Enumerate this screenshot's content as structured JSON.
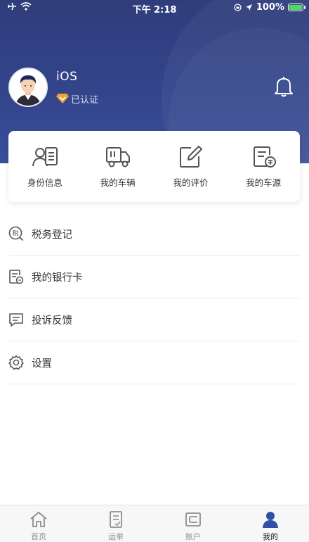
{
  "status_bar": {
    "time": "下午 2:18",
    "battery": "100%"
  },
  "profile": {
    "username": "iOS",
    "verified_label": "已认证"
  },
  "quick_actions": [
    {
      "label": "身份信息",
      "icon": "id-card-icon"
    },
    {
      "label": "我的车辆",
      "icon": "truck-icon"
    },
    {
      "label": "我的评价",
      "icon": "edit-icon"
    },
    {
      "label": "我的车源",
      "icon": "document-icon"
    }
  ],
  "menu": [
    {
      "label": "税务登记",
      "icon": "tax-icon"
    },
    {
      "label": "我的银行卡",
      "icon": "bank-card-icon"
    },
    {
      "label": "投诉反馈",
      "icon": "message-icon"
    },
    {
      "label": "设置",
      "icon": "gear-icon"
    }
  ],
  "tabs": [
    {
      "label": "首页",
      "icon": "home-icon",
      "active": false
    },
    {
      "label": "运单",
      "icon": "waybill-icon",
      "active": false
    },
    {
      "label": "账户",
      "icon": "wallet-icon",
      "active": false
    },
    {
      "label": "我的",
      "icon": "profile-icon",
      "active": true
    }
  ],
  "colors": {
    "header": "#33448a",
    "active_tab": "#2f4fa8",
    "icon_gray": "#555555",
    "tab_inactive": "#8e8e8e"
  }
}
